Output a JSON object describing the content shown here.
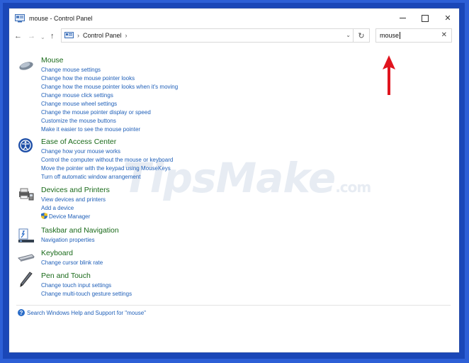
{
  "window": {
    "title": "mouse - Control Panel",
    "minimize_icon": "minimize-icon",
    "maximize_icon": "maximize-icon",
    "close_glyph": "✕"
  },
  "nav": {
    "back_glyph": "←",
    "forward_glyph": "→",
    "recent_glyph": "⌄",
    "up_glyph": "↑",
    "address_separator": "›",
    "breadcrumb": "Control Panel",
    "breadcrumb_trailing": "›",
    "dropdown_glyph": "⌄",
    "refresh_glyph": "↻"
  },
  "search": {
    "value": "mouse",
    "clear_glyph": "✕"
  },
  "groups": [
    {
      "title": "Mouse",
      "icon": "mouse-icon",
      "links": [
        "Change mouse settings",
        "Change how the mouse pointer looks",
        "Change how the mouse pointer looks when it's moving",
        "Change mouse click settings",
        "Change mouse wheel settings",
        "Change the mouse pointer display or speed",
        "Customize the mouse buttons",
        "Make it easier to see the mouse pointer"
      ]
    },
    {
      "title": "Ease of Access Center",
      "icon": "ease-of-access-icon",
      "links": [
        "Change how your mouse works",
        "Control the computer without the mouse or keyboard",
        "Move the pointer with the keypad using MouseKeys",
        "Turn off automatic window arrangement"
      ]
    },
    {
      "title": "Devices and Printers",
      "icon": "printer-icon",
      "links": [
        "View devices and printers",
        "Add a device",
        "Device Manager"
      ]
    },
    {
      "title": "Taskbar and Navigation",
      "icon": "taskbar-icon",
      "links": [
        "Navigation properties"
      ]
    },
    {
      "title": "Keyboard",
      "icon": "keyboard-icon",
      "links": [
        "Change cursor blink rate"
      ]
    },
    {
      "title": "Pen and Touch",
      "icon": "pen-icon",
      "links": [
        "Change touch input settings",
        "Change multi-touch gesture settings"
      ]
    }
  ],
  "help": {
    "glyph": "?",
    "text": "Search Windows Help and Support for \"mouse\""
  },
  "watermark": {
    "text": "TipsMake",
    "suffix": ".com"
  },
  "colors": {
    "group_title": "#1a6a1a",
    "link": "#1f5fb8",
    "annotation_arrow": "#e0141e",
    "desktop_border": "#2d5fd6"
  }
}
